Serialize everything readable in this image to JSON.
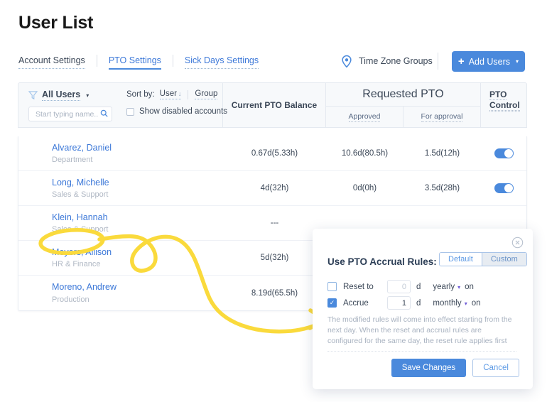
{
  "page": {
    "title": "User List"
  },
  "tabs": [
    {
      "label": "Account Settings",
      "state": "plain"
    },
    {
      "label": "PTO Settings",
      "state": "active"
    },
    {
      "label": "Sick Days Settings",
      "state": "link"
    }
  ],
  "header": {
    "time_zone_groups": "Time Zone Groups",
    "pin_icon": "map-pin-icon",
    "add_users": "Add Users",
    "add_users_plus": "+",
    "add_users_caret": "▾",
    "accent_color": "#4a89dc"
  },
  "filter": {
    "funnel_icon": "funnel-icon",
    "all_users": "All Users",
    "caret": "▾",
    "search_placeholder": "Start typing name...",
    "search_value": "",
    "search_icon": "magnifier-icon"
  },
  "sort": {
    "label": "Sort by:",
    "option_user": "User",
    "option_user_arrow": "↓",
    "option_group": "Group",
    "show_disabled": "Show disabled accounts",
    "show_disabled_checked": false
  },
  "columns": {
    "balance": "Current PTO Balance",
    "requested": "Requested PTO",
    "approved": "Approved",
    "for_approval": "For approval",
    "control_line1": "PTO",
    "control_line2": "Control"
  },
  "rows": [
    {
      "name": "Alvarez, Daniel",
      "dept": "Department",
      "balance": "0.67d(5.33h)",
      "approved": "10.6d(80.5h)",
      "for_approval": "1.5d(12h)",
      "toggle_on": true
    },
    {
      "name": "Long, Michelle",
      "dept": "Sales & Support",
      "balance": "4d(32h)",
      "approved": "0d(0h)",
      "for_approval": "3.5d(28h)",
      "toggle_on": true
    },
    {
      "name": "Klein, Hannah",
      "dept": "Sales & Support",
      "balance": "---",
      "approved": "",
      "for_approval": "",
      "toggle_on": false
    },
    {
      "name": "Meyers, Allison",
      "dept": "HR & Finance",
      "balance": "5d(32h)",
      "approved": "",
      "for_approval": "",
      "toggle_on": false
    },
    {
      "name": "Moreno, Andrew",
      "dept": "Production",
      "balance": "8.19d(65.5h)",
      "approved": "",
      "for_approval": "",
      "toggle_on": false
    }
  ],
  "modal": {
    "close_icon": "close-circle-icon",
    "title": "Use PTO Accrual Rules:",
    "segment_default": "Default",
    "segment_custom": "Custom",
    "segment_selected": "Custom",
    "reset": {
      "label": "Reset to",
      "checked": false,
      "value": "0",
      "placeholder": "0",
      "unit": "d",
      "frequency": "yearly",
      "caret": "▾",
      "on": "on"
    },
    "accrue": {
      "label": "Accrue",
      "checked": true,
      "check_glyph": "✓",
      "value": "1",
      "unit": "d",
      "frequency": "monthly",
      "caret": "▾",
      "on": "on"
    },
    "note": "The modified rules will come into effect starting from the next day. When the reset and accrual rules are configured for the same day, the reset rule applies first",
    "save": "Save Changes",
    "cancel": "Cancel"
  },
  "annotation": {
    "color": "#fada3c",
    "shape": "hand-drawn-arrow-with-ellipse-and-loop"
  }
}
